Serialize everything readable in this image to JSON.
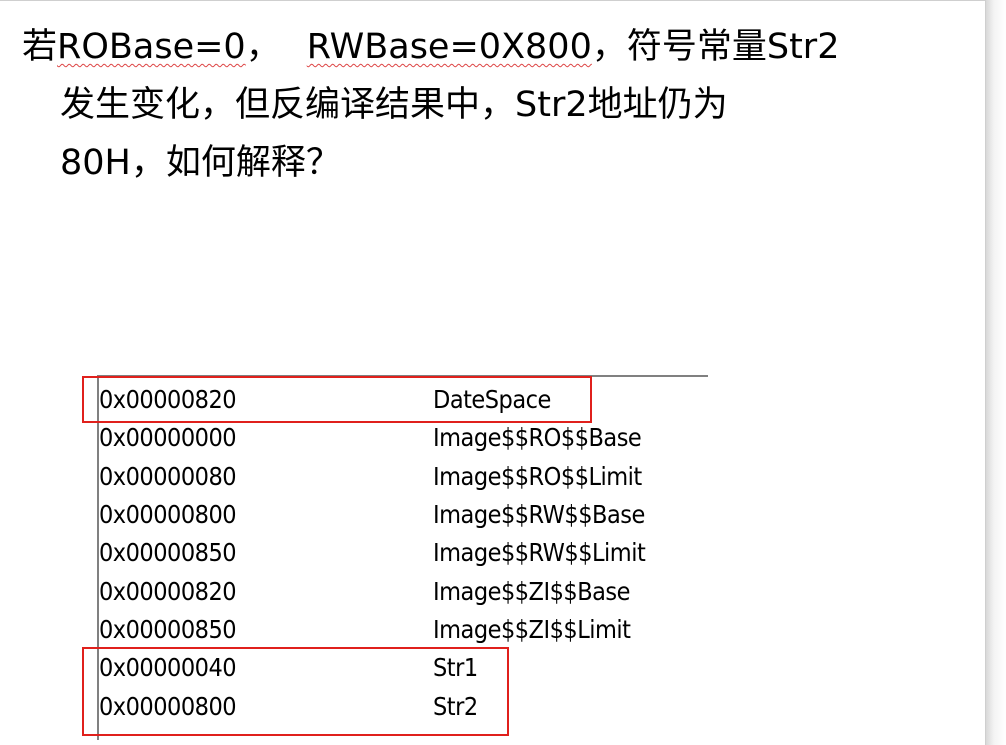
{
  "question": {
    "line1_part1": "若",
    "line1_robase": "ROBase=0",
    "line1_sep": "，",
    "line1_rwbase": "RWBase=0X800",
    "line1_rest": "，符号常量Str2",
    "line2": "发生变化，但反编译结果中，Str2地址仍为",
    "line3": "80H，如何解释？"
  },
  "symbol_table": {
    "rows": [
      {
        "address": "0x00000820",
        "symbol": "DateSpace"
      },
      {
        "address": "0x00000000",
        "symbol": "Image$$RO$$Base"
      },
      {
        "address": "0x00000080",
        "symbol": "Image$$RO$$Limit"
      },
      {
        "address": "0x00000800",
        "symbol": "Image$$RW$$Base"
      },
      {
        "address": "0x00000850",
        "symbol": "Image$$RW$$Limit"
      },
      {
        "address": "0x00000820",
        "symbol": "Image$$ZI$$Base"
      },
      {
        "address": "0x00000850",
        "symbol": "Image$$ZI$$Limit"
      },
      {
        "address": "0x00000040",
        "symbol": "Str1"
      },
      {
        "address": "0x00000800",
        "symbol": "Str2"
      }
    ]
  },
  "colors": {
    "highlight_border": "#e0201c",
    "text": "#000000",
    "background": "#ffffff"
  }
}
